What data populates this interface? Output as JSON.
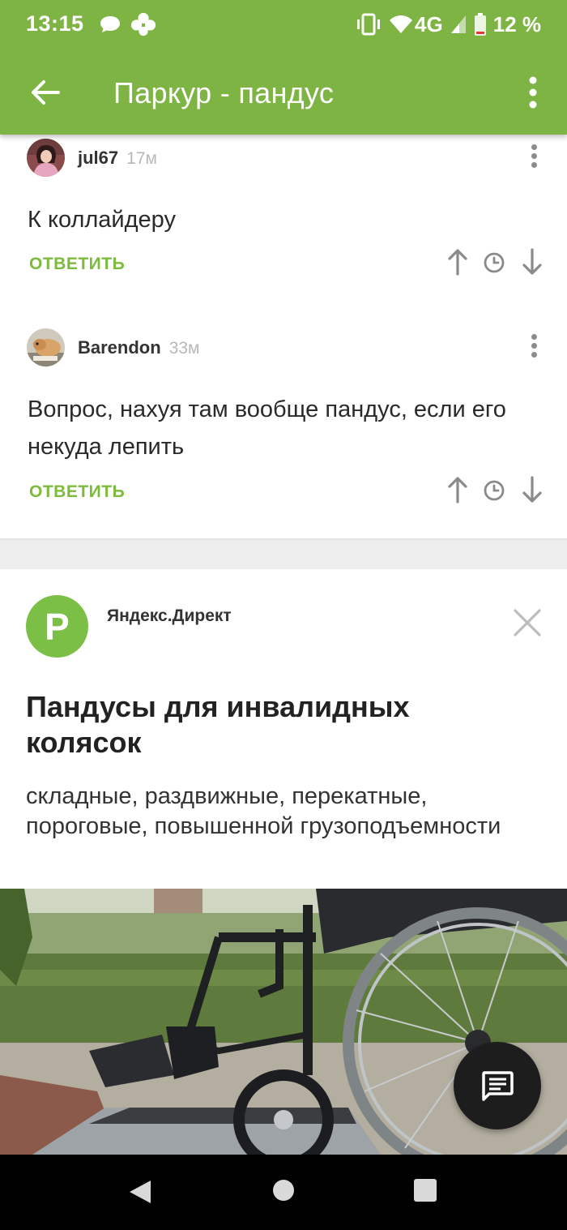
{
  "status_bar": {
    "time": "13:15",
    "network": "4G",
    "battery": "12 %"
  },
  "app_bar": {
    "title": "Паркур - пандус"
  },
  "comments": [
    {
      "username": "jul67",
      "ago": "17м",
      "text": "К коллайдеру",
      "reply_label": "ОТВЕТИТЬ"
    },
    {
      "username": "Barendon",
      "ago": "33м",
      "text": "Вопрос, нахуя там вообще пандус, если его некуда лепить",
      "reply_label": "ОТВЕТИТЬ"
    }
  ],
  "ad": {
    "logo_letter": "P",
    "source": "Яндекс.Директ",
    "headline": "Пандусы для инвалидных колясок",
    "description": "складные, раздвижные, перекатные, пороговые, повышенной грузоподъемности"
  },
  "colors": {
    "brand_green": "#7db443",
    "reply_green": "#7cbb3b",
    "ad_logo_green": "#7cbf46"
  },
  "icons": {
    "back": "arrow-left-icon",
    "menu": "more-vertical-icon",
    "upvote": "arrow-up-icon",
    "history": "clock-icon",
    "downvote": "arrow-down-icon",
    "close": "close-icon",
    "chat": "chat-icon"
  }
}
